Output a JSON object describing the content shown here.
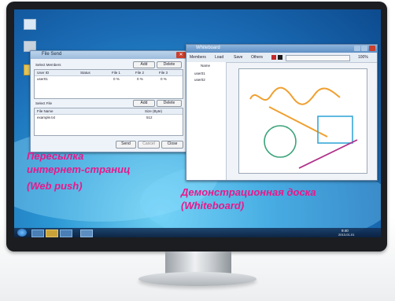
{
  "captions": {
    "web_push_lines": [
      "Пересылка",
      "интернет-страниц",
      "(Web push)"
    ],
    "whiteboard_lines": [
      "Демонстрационная доска",
      "(Whiteboard)"
    ]
  },
  "send_window": {
    "title": "File Send",
    "members_label": "Select Members",
    "add_label": "Add",
    "delete_label": "Delete",
    "members_columns": [
      "User ID",
      "Status",
      "File 1",
      "File 2",
      "File 3"
    ],
    "members_rows": [
      {
        "user": "user01",
        "status": "",
        "f1": "0 %",
        "f2": "0 %",
        "f3": "0 %"
      }
    ],
    "files_label": "Select File",
    "files_columns": [
      "File Name",
      "Size (Byte)"
    ],
    "files_rows": [
      {
        "name": "example.txt",
        "size": "512"
      }
    ],
    "send_label": "Send",
    "cancel_label": "Cancel",
    "close_label": "Close"
  },
  "whiteboard_window": {
    "title": "Whiteboard",
    "toolbar": [
      "Members",
      "Load",
      "Save",
      "Others"
    ],
    "zoom": "100%",
    "list_header": "Name",
    "list_items": [
      "user01",
      "user02"
    ]
  },
  "taskbar": {
    "time": "9:40",
    "date": "2013-01-01"
  },
  "colors": {
    "caption": "#e8198b",
    "wb_orange": "#f0a030",
    "wb_blue": "#38a8d8",
    "wb_green": "#3aa37a",
    "wb_purple": "#b0308a"
  }
}
